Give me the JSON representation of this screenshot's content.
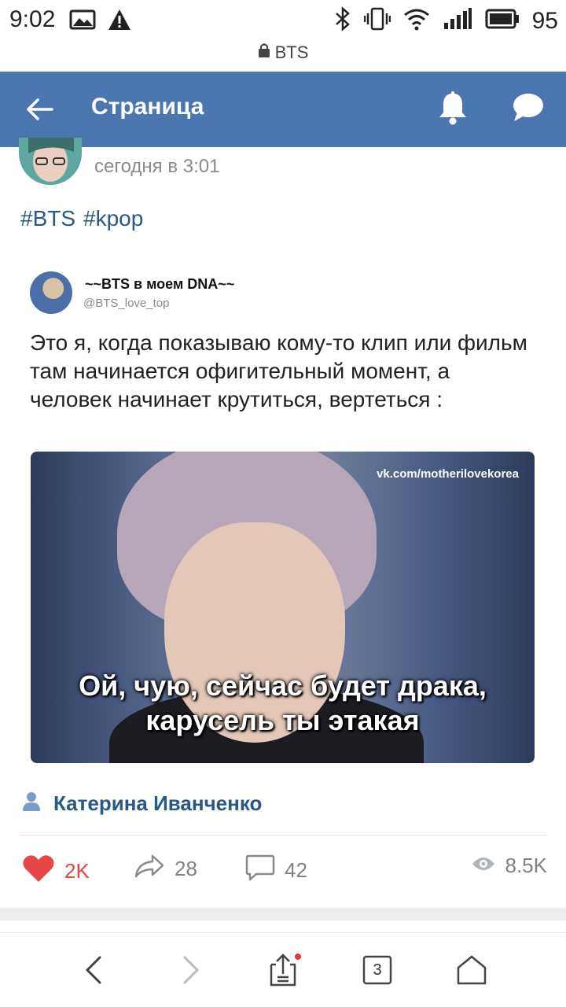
{
  "status_bar": {
    "time": "9:02",
    "battery": "95",
    "icons": [
      "image-icon",
      "warning-icon",
      "bluetooth-icon",
      "vibrate-icon",
      "wifi-icon",
      "signal-icon",
      "battery-icon"
    ]
  },
  "url_bar": {
    "domain": "BTS"
  },
  "header": {
    "title": "Страница"
  },
  "post": {
    "time": "сегодня в 3:01",
    "hashtags": [
      "#BTS",
      "#kpop"
    ],
    "tweet": {
      "name": "~~BTS в моем DNA~~",
      "handle": "@BTS_love_top",
      "text": "Это я,  когда показываю кому-то клип или фильм там начинается офигительный момент,  а человек начинает крутиться, вертеться :"
    },
    "meme": {
      "watermark": "vk.com/motherilovekorea",
      "caption_line1": "Ой, чую, сейчас будет драка,",
      "caption_line2": "карусель ты этакая"
    },
    "source_author": "Катерина Иванченко",
    "actions": {
      "likes": "2K",
      "shares": "28",
      "comments": "42",
      "views": "8.5K"
    }
  },
  "browser_nav": {
    "tabs_count": "3"
  },
  "colors": {
    "header_bg": "#4b77b1",
    "link": "#2a5885",
    "like": "#e64646",
    "muted": "#828282"
  }
}
